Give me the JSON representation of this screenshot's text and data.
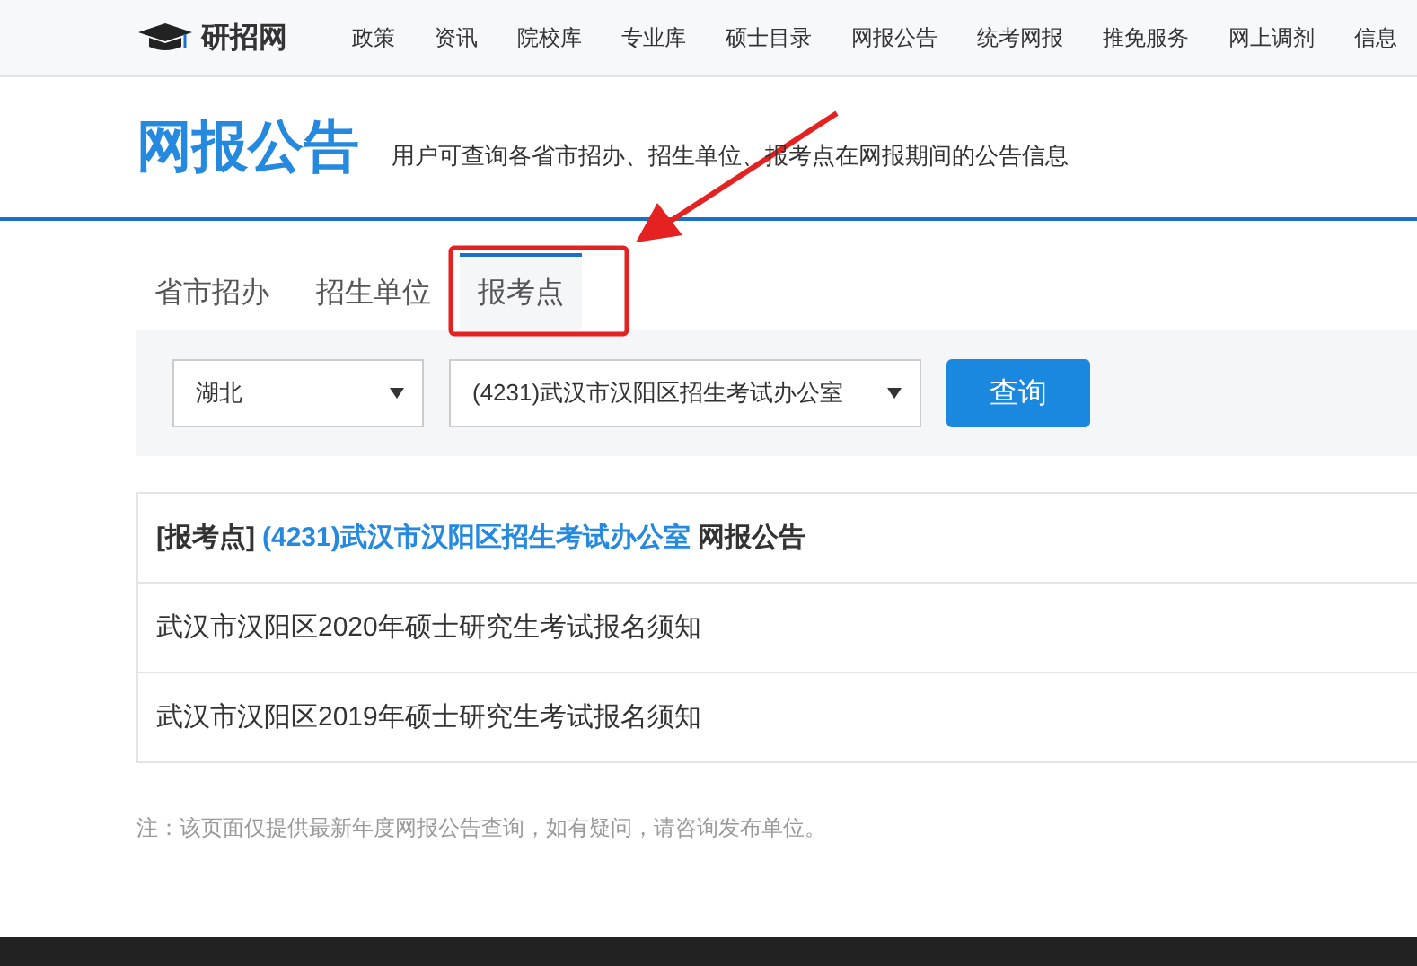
{
  "site": {
    "logo_text": "研招网"
  },
  "nav": [
    "政策",
    "资讯",
    "院校库",
    "专业库",
    "硕士目录",
    "网报公告",
    "统考网报",
    "推免服务",
    "网上调剂",
    "信息"
  ],
  "page": {
    "title": "网报公告",
    "subtitle": "用户可查询各省市招办、招生单位、报考点在网报期间的公告信息"
  },
  "tabs": [
    {
      "label": "省市招办",
      "selected": false
    },
    {
      "label": "招生单位",
      "selected": false
    },
    {
      "label": "报考点",
      "selected": true
    }
  ],
  "filters": {
    "province": "湖北",
    "site": "(4231)武汉市汉阳区招生考试办公室",
    "button": "查询"
  },
  "results": {
    "heading_prefix": "[报考点]",
    "heading_unit": "(4231)武汉市汉阳区招生考试办公室",
    "heading_suffix": "网报公告",
    "items": [
      "武汉市汉阳区2020年硕士研究生考试报名须知",
      "武汉市汉阳区2019年硕士研究生考试报名须知"
    ]
  },
  "note": "注：该页面仅提供最新年度网报公告查询，如有疑问，请咨询发布单位。"
}
